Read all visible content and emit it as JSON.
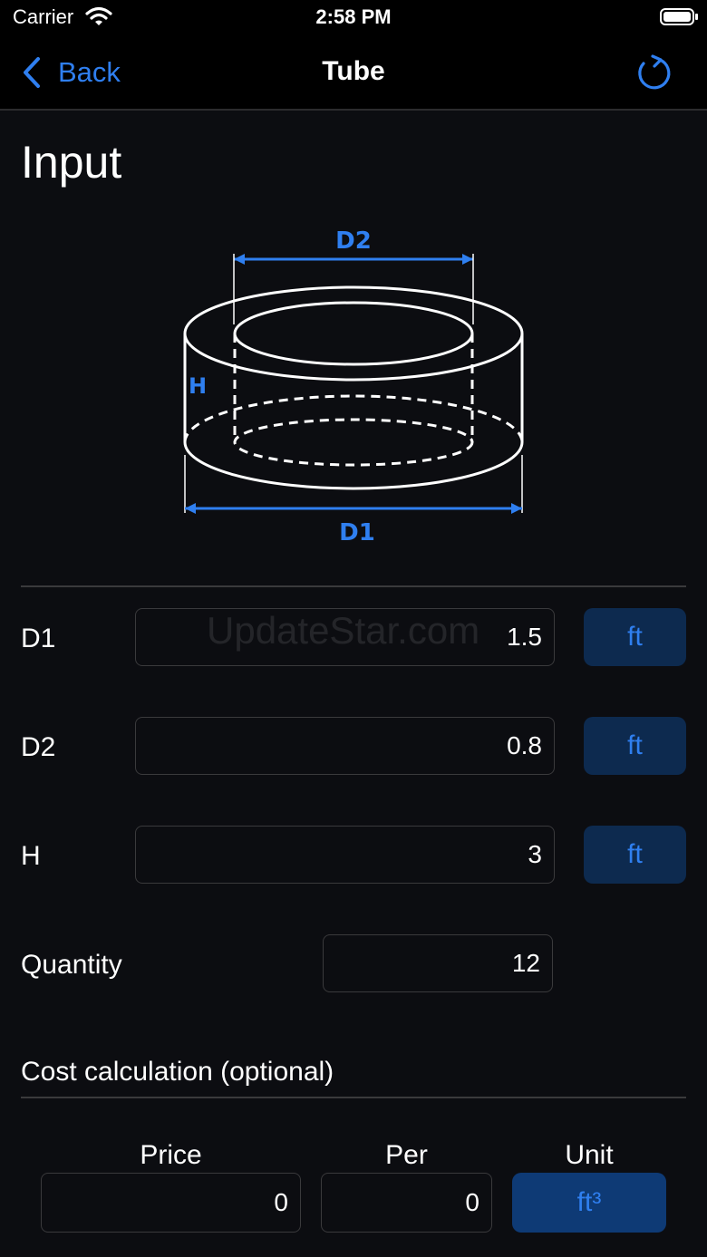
{
  "status_bar": {
    "carrier": "Carrier",
    "time": "2:58 PM"
  },
  "nav": {
    "back_label": "Back",
    "title": "Tube"
  },
  "input_section": {
    "title": "Input"
  },
  "diagram": {
    "d1_label": "D1",
    "d2_label": "D2",
    "h_label": "H"
  },
  "watermark": "UpdateStar.com",
  "fields": {
    "d1": {
      "label": "D1",
      "value": "1.5",
      "unit": "ft"
    },
    "d2": {
      "label": "D2",
      "value": "0.8",
      "unit": "ft"
    },
    "h": {
      "label": "H",
      "value": "3",
      "unit": "ft"
    },
    "quantity": {
      "label": "Quantity",
      "value": "12"
    }
  },
  "cost": {
    "title": "Cost calculation (optional)",
    "price_header": "Price",
    "per_header": "Per",
    "unit_header": "Unit",
    "price_value": "0",
    "per_value": "0",
    "unit_value": "ft³"
  },
  "colors": {
    "accent": "#2f7ff0",
    "background": "#0c0d11",
    "unit_button": "#0d2a4f"
  }
}
